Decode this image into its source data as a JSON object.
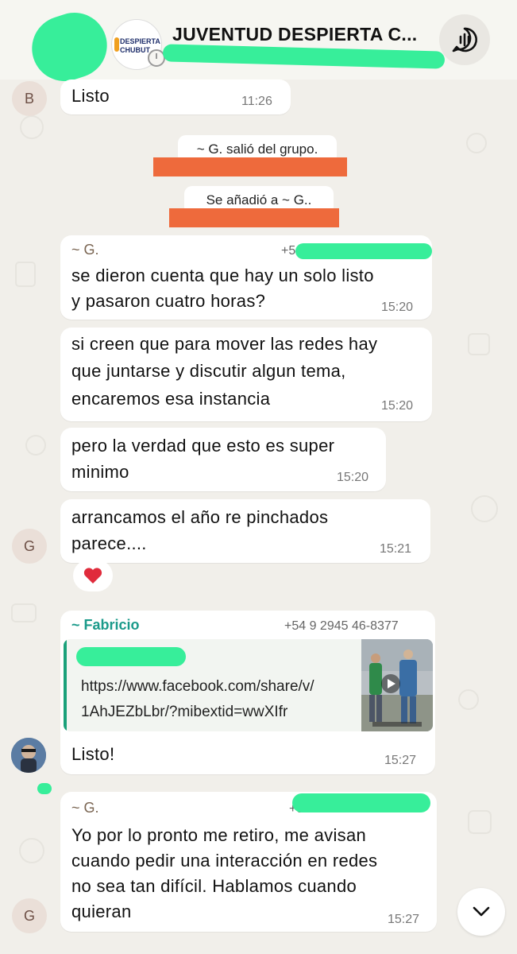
{
  "header": {
    "title": "JUVENTUD DESPIERTA C...",
    "logo_line1": "DESPIERTA",
    "logo_line2": "CHUBUT",
    "call_icon": "group-call-icon"
  },
  "messages": [
    {
      "avatar": "B",
      "text": "Listo",
      "time": "11:26"
    },
    {
      "system": "~ G. salió del grupo."
    },
    {
      "system": "Se añadió a ~ G.."
    },
    {
      "sender": "~ G.",
      "phone": "+5",
      "text": [
        "se dieron cuenta que hay un solo listo",
        "y pasaron cuatro horas?"
      ],
      "time": "15:20"
    },
    {
      "text": [
        "si creen que para mover las redes hay",
        "que juntarse y discutir algun tema,",
        "encaremos esa instancia"
      ],
      "time": "15:20"
    },
    {
      "text": [
        "pero la verdad que esto es super",
        "minimo"
      ],
      "time": "15:20"
    },
    {
      "avatar": "G",
      "text": [
        "arrancamos el año re pinchados",
        "parece...."
      ],
      "time": "15:21",
      "reaction": "❤️"
    },
    {
      "sender": "~ Fabricio",
      "phone": "+54 9 2945 46-8377",
      "quote_url": [
        "https://www.facebook.com/share/v/",
        "1AhJEZbLbr/?mibextid=wwXIfr"
      ],
      "text": "Listo!",
      "time": "15:27"
    },
    {
      "avatar": "G",
      "sender": "~ G.",
      "phone": "+54 9",
      "text": [
        "Yo por lo pronto me retiro, me avisan",
        "cuando pedir una interacción en redes",
        "no sea tan difícil. Hablamos cuando",
        "quieran"
      ],
      "time": "15:27"
    }
  ],
  "colors": {
    "sender_g": "#7a6552",
    "sender_fabricio": "#1a9a8a",
    "redact_green": "#37ee9a",
    "redact_orange": "#ee6a3c"
  }
}
